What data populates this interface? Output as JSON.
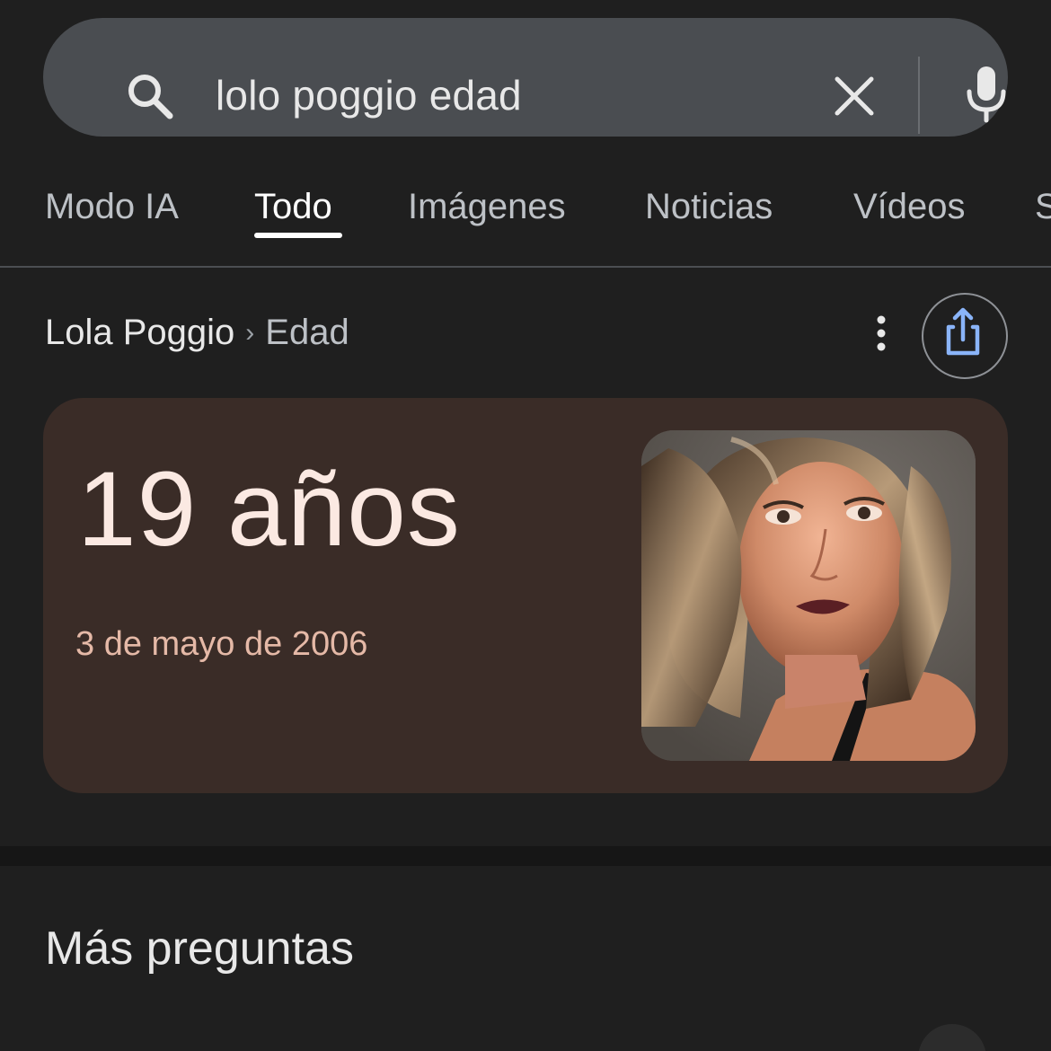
{
  "search": {
    "query": "lolo poggio edad",
    "icons": {
      "search": "search-icon",
      "clear": "close-icon",
      "voice": "microphone-icon"
    }
  },
  "tabs": [
    {
      "label": "Modo IA",
      "active": false
    },
    {
      "label": "Todo",
      "active": true
    },
    {
      "label": "Imágenes",
      "active": false
    },
    {
      "label": "Noticias",
      "active": false
    },
    {
      "label": "Vídeos",
      "active": false
    },
    {
      "label": "S",
      "active": false
    }
  ],
  "breadcrumb": {
    "entity": "Lola Poggio",
    "attribute": "Edad",
    "separator": "›"
  },
  "answer": {
    "age": "19 años",
    "birth_date": "3 de mayo de 2006",
    "photo": "portrait-photo"
  },
  "section": {
    "title": "Más preguntas"
  },
  "colors": {
    "background": "#1f1f1f",
    "search_bar": "#4a4d51",
    "card": "#3a2c27",
    "age_text": "#fbe9e2",
    "birth_text": "#e5b9a7",
    "share_accent": "#8ab4f8"
  }
}
